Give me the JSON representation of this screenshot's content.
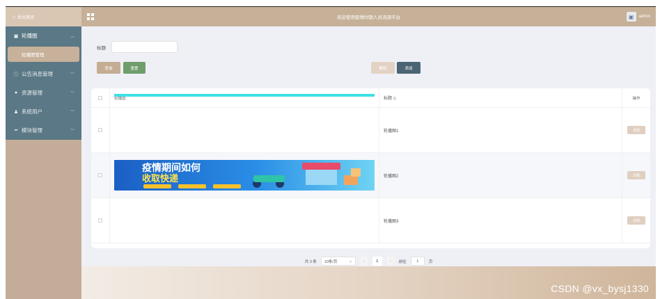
{
  "sidebar": {
    "home_label": "后台首页",
    "menu": [
      {
        "label": "轮播图",
        "icon": "image-icon",
        "open": true
      },
      {
        "label": "公告消息管理",
        "icon": "info-circle-icon"
      },
      {
        "label": "资源管理",
        "icon": "location-pin-icon"
      },
      {
        "label": "系统用户",
        "icon": "user-icon"
      },
      {
        "label": "模块管理",
        "icon": "grid-icon"
      }
    ],
    "submenu_active": "轮播图管理"
  },
  "header": {
    "title": "欢迎使用疫情时期人员流调平台",
    "username": "admin"
  },
  "search": {
    "label": "标题",
    "value": "",
    "search_btn": "查询",
    "reset_btn": "重置",
    "delete_btn": "删除",
    "add_btn": "添加"
  },
  "table": {
    "col_image": "轮播图",
    "col_title": "标题 ◇",
    "col_op": "操作",
    "detail_label": "详情",
    "rows": [
      {
        "title": "轮播图1"
      },
      {
        "title": "轮播图2",
        "banner_text": "疫情期间如何",
        "banner_sub": "收取快递"
      },
      {
        "title": "轮播图3"
      }
    ]
  },
  "pager": {
    "total": "共 3 条",
    "page_size": "10条/页",
    "current": "1",
    "goto_prefix": "前往",
    "goto_value": "1",
    "goto_suffix": "页"
  },
  "watermark": "CSDN @vx_bysj1330",
  "colors": {
    "sidebar_menu": "#5a7885",
    "header": "#c6b198",
    "accent": "#4b6473",
    "cyan_bar": "#3ee0e8"
  }
}
